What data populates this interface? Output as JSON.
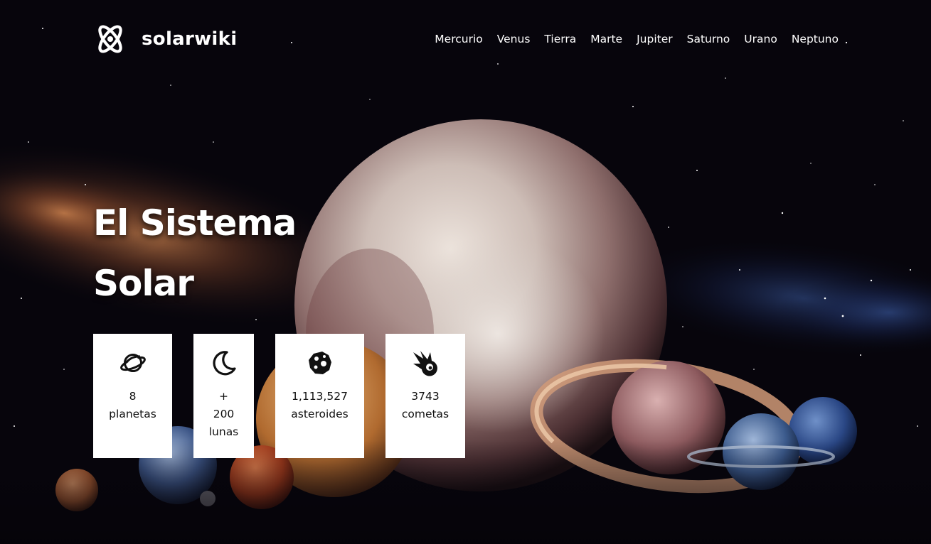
{
  "brand": {
    "name": "solarwiki",
    "logo_icon": "atom-icon"
  },
  "nav": {
    "items": [
      {
        "label": "Mercurio"
      },
      {
        "label": "Venus"
      },
      {
        "label": "Tierra"
      },
      {
        "label": "Marte"
      },
      {
        "label": "Jupiter"
      },
      {
        "label": "Saturno"
      },
      {
        "label": "Urano"
      },
      {
        "label": "Neptuno"
      }
    ]
  },
  "hero": {
    "title_line1": "El Sistema",
    "title_line2": "Solar"
  },
  "stats": [
    {
      "icon": "planet-icon",
      "lines": [
        "8",
        "planetas"
      ]
    },
    {
      "icon": "moon-icon",
      "lines": [
        "+",
        "200",
        "lunas"
      ]
    },
    {
      "icon": "asteroid-icon",
      "lines": [
        "1,113,527",
        "asteroides"
      ]
    },
    {
      "icon": "comet-icon",
      "lines": [
        "3743",
        "cometas"
      ]
    }
  ],
  "colors": {
    "background": "#07050c",
    "text": "#ffffff",
    "card_background": "#ffffff",
    "card_text": "#111111"
  }
}
